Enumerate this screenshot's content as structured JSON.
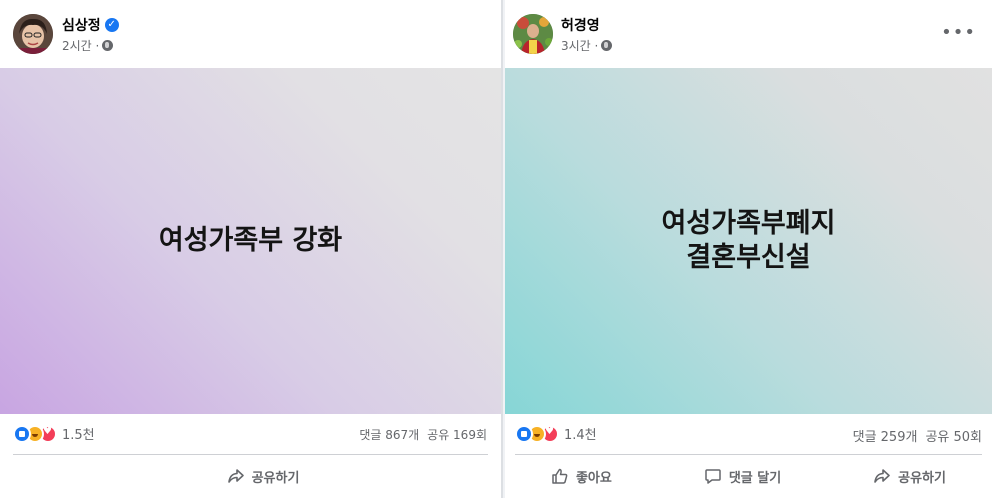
{
  "posts": [
    {
      "author": "심상정",
      "verified": true,
      "time": "2시간 ·",
      "card_text": "여성가족부 강화",
      "reactions": [
        "like-icon",
        "haha-icon",
        "love-icon"
      ],
      "reaction_count": "1.5천",
      "comments": "댓글 867개",
      "shares": "공유 169회",
      "actions": {
        "share": "공유하기"
      },
      "gradient": [
        "#c8a5e2",
        "#e4e4e4"
      ]
    },
    {
      "author": "허경영",
      "verified": false,
      "time": "3시간 ·",
      "card_text": "여성가족부폐지\n결혼부신설",
      "reactions": [
        "like-icon",
        "haha-icon",
        "love-icon"
      ],
      "reaction_count": "1.4천",
      "comments": "댓글 259개",
      "shares": "공유 50회",
      "actions": {
        "like": "좋아요",
        "comment": "댓글 달기",
        "share": "공유하기"
      },
      "more_icon": "more-options-icon",
      "gradient": [
        "#86d6d6",
        "#e1e1e1"
      ]
    }
  ],
  "colors": {
    "accent": "#1877f2",
    "meta_text": "#65676b",
    "haha": "#f7b125",
    "love": "#f33e58"
  }
}
